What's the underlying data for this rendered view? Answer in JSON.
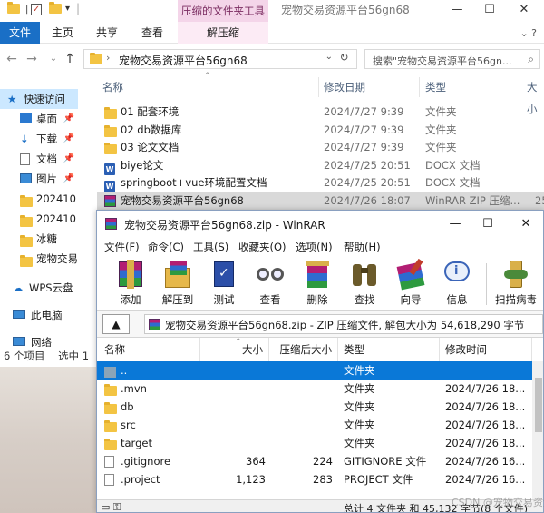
{
  "explorer": {
    "context_tab_title": "压缩的文件夹工具",
    "window_title": "宠物交易资源平台56gn68",
    "ribbon_tabs": [
      "文件",
      "主页",
      "共享",
      "查看",
      "解压缩"
    ],
    "address": {
      "path": "宠物交易资源平台56gn68",
      "search_placeholder": "搜索\"宠物交易资源平台56gn..."
    },
    "columns": {
      "name": "名称",
      "date": "修改日期",
      "type": "类型",
      "size": "大小"
    },
    "files": [
      {
        "name": "01 配套环境",
        "date": "2024/7/27 9:39",
        "type": "文件夹",
        "size": "",
        "icon": "folder-icon"
      },
      {
        "name": "02 db数据库",
        "date": "2024/7/27 9:39",
        "type": "文件夹",
        "size": "",
        "icon": "folder-icon"
      },
      {
        "name": "03 论文文档",
        "date": "2024/7/27 9:39",
        "type": "文件夹",
        "size": "",
        "icon": "folder-icon"
      },
      {
        "name": "biye论文",
        "date": "2024/7/25 20:51",
        "type": "DOCX 文档",
        "size": "",
        "icon": "docx-icon"
      },
      {
        "name": "springboot+vue环境配置文档",
        "date": "2024/7/25 20:51",
        "type": "DOCX 文档",
        "size": "",
        "icon": "docx-icon"
      },
      {
        "name": "宠物交易资源平台56gn68",
        "date": "2024/7/26 18:07",
        "type": "WinRAR ZIP 压缩...",
        "size": "25",
        "icon": "winrar-zip-icon"
      }
    ],
    "nav_items": [
      {
        "label": "快速访问",
        "pinned": false,
        "icon": "star-icon"
      },
      {
        "label": "桌面",
        "pinned": true,
        "icon": "desktop-icon"
      },
      {
        "label": "下载",
        "pinned": true,
        "icon": "download-icon"
      },
      {
        "label": "文档",
        "pinned": true,
        "icon": "document-icon"
      },
      {
        "label": "图片",
        "pinned": true,
        "icon": "picture-icon"
      },
      {
        "label": "202410",
        "pinned": false,
        "icon": "folder-icon"
      },
      {
        "label": "202410",
        "pinned": false,
        "icon": "folder-icon"
      },
      {
        "label": "冰糖",
        "pinned": false,
        "icon": "folder-icon"
      },
      {
        "label": "宠物交易",
        "pinned": false,
        "icon": "folder-icon"
      },
      {
        "label": "WPS云盘",
        "pinned": false,
        "icon": "cloud-icon"
      },
      {
        "label": "此电脑",
        "pinned": false,
        "icon": "computer-icon"
      },
      {
        "label": "网络",
        "pinned": false,
        "icon": "network-icon"
      }
    ],
    "status": {
      "count": "6 个项目",
      "selected": "选中 1"
    }
  },
  "winrar": {
    "title": "宠物交易资源平台56gn68.zip - WinRAR",
    "menu": [
      "文件(F)",
      "命令(C)",
      "工具(S)",
      "收藏夹(O)",
      "选项(N)",
      "帮助(H)"
    ],
    "tools": [
      {
        "label": "添加",
        "icon": "add-archive-icon"
      },
      {
        "label": "解压到",
        "icon": "extract-to-icon"
      },
      {
        "label": "测试",
        "icon": "test-icon"
      },
      {
        "label": "查看",
        "icon": "view-icon"
      },
      {
        "label": "删除",
        "icon": "delete-icon"
      },
      {
        "label": "查找",
        "icon": "find-icon"
      },
      {
        "label": "向导",
        "icon": "wizard-icon"
      },
      {
        "label": "信息",
        "icon": "info-icon"
      },
      {
        "label": "扫描病毒",
        "icon": "virus-scan-icon"
      }
    ],
    "path_text": "宠物交易资源平台56gn68.zip - ZIP 压缩文件, 解包大小为 54,618,290 字节",
    "columns": {
      "name": "名称",
      "size": "大小",
      "packed": "压缩后大小",
      "type": "类型",
      "modified": "修改时间"
    },
    "rows": [
      {
        "name": "..",
        "size": "",
        "packed": "",
        "type": "文件夹",
        "modified": "",
        "icon": "up-folder-icon"
      },
      {
        "name": ".mvn",
        "size": "",
        "packed": "",
        "type": "文件夹",
        "modified": "2024/7/26 18...",
        "icon": "folder-icon"
      },
      {
        "name": "db",
        "size": "",
        "packed": "",
        "type": "文件夹",
        "modified": "2024/7/26 18...",
        "icon": "folder-icon"
      },
      {
        "name": "src",
        "size": "",
        "packed": "",
        "type": "文件夹",
        "modified": "2024/7/26 18...",
        "icon": "folder-icon"
      },
      {
        "name": "target",
        "size": "",
        "packed": "",
        "type": "文件夹",
        "modified": "2024/7/26 18...",
        "icon": "folder-icon"
      },
      {
        "name": ".gitignore",
        "size": "364",
        "packed": "224",
        "type": "GITIGNORE 文件",
        "modified": "2024/7/26 16...",
        "icon": "file-icon"
      },
      {
        "name": ".project",
        "size": "1,123",
        "packed": "283",
        "type": "PROJECT 文件",
        "modified": "2024/7/26 16...",
        "icon": "file-icon"
      }
    ],
    "status_right": "总计 4 文件夹 和 45,132 字节(8 个文件)"
  },
  "watermark": "CSDN @宠物交易资源"
}
